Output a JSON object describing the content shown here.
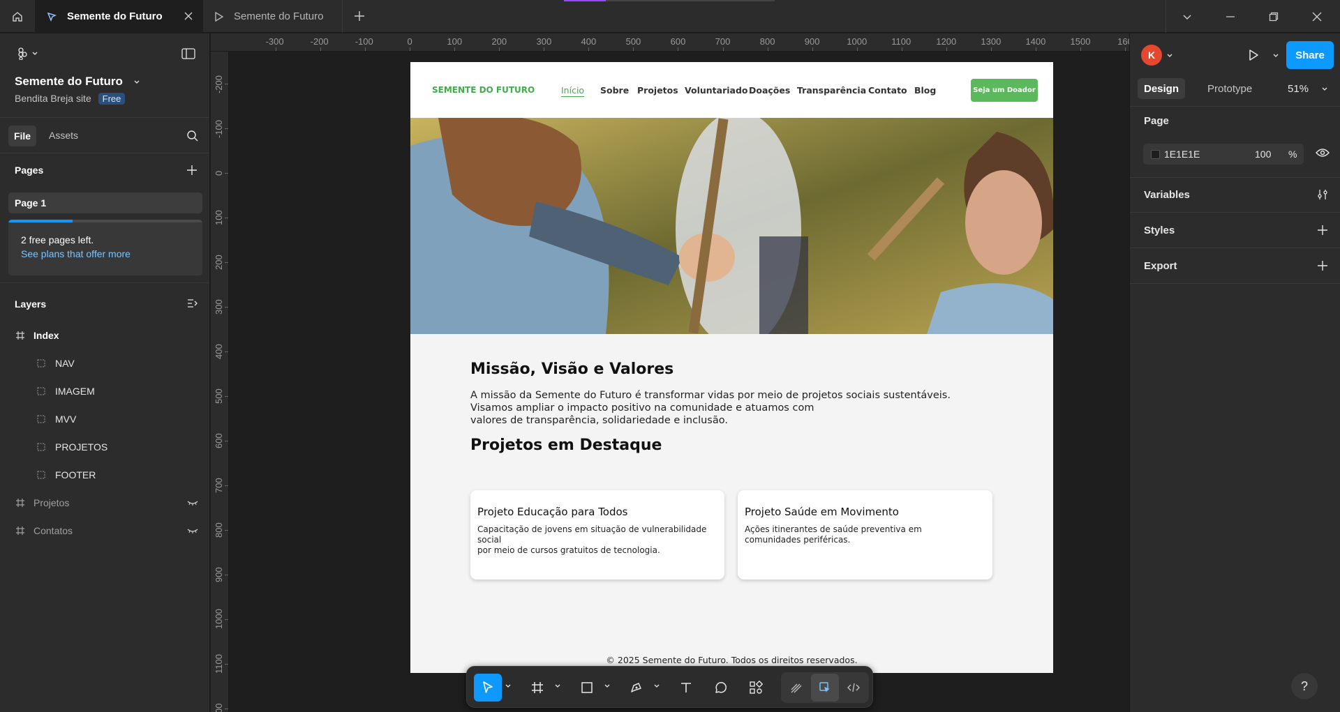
{
  "titlebar": {
    "tabs": [
      {
        "label": "Semente do Futuro",
        "active": true
      },
      {
        "label": "Semente do Futuro",
        "active": false
      }
    ]
  },
  "left_panel": {
    "file_name": "Semente do Futuro",
    "team_name": "Bendita Breja site",
    "plan_badge": "Free",
    "tabs": {
      "file": "File",
      "assets": "Assets"
    },
    "pages_header": "Pages",
    "pages": [
      "Page 1"
    ],
    "upsell": {
      "text": "2 free pages left.",
      "link": "See plans that offer more",
      "progress": 0.33
    },
    "layers_header": "Layers",
    "layers": [
      {
        "name": "Index",
        "level": 0,
        "type": "frame",
        "hidden": false
      },
      {
        "name": "NAV",
        "level": 1,
        "type": "section",
        "hidden": false
      },
      {
        "name": "IMAGEM",
        "level": 1,
        "type": "section",
        "hidden": false
      },
      {
        "name": "MVV",
        "level": 1,
        "type": "section",
        "hidden": false
      },
      {
        "name": "PROJETOS",
        "level": 1,
        "type": "section",
        "hidden": false
      },
      {
        "name": "FOOTER",
        "level": 1,
        "type": "section",
        "hidden": false
      },
      {
        "name": "Projetos",
        "level": 0,
        "type": "frame",
        "hidden": true
      },
      {
        "name": "Contatos",
        "level": 0,
        "type": "frame",
        "hidden": true
      }
    ]
  },
  "rulers": {
    "top": [
      "-300",
      "-200",
      "-100",
      "0",
      "100",
      "200",
      "300",
      "400",
      "500",
      "600",
      "700",
      "800",
      "900",
      "1000",
      "1100",
      "1200",
      "1300",
      "1400",
      "1500",
      "160"
    ],
    "left": [
      "-200",
      "-100",
      "0",
      "100",
      "200",
      "300",
      "400",
      "500",
      "600",
      "700",
      "800",
      "900",
      "1000",
      "1100",
      "00"
    ]
  },
  "frame_label": "Index",
  "site": {
    "logo": "SEMENTE DO FUTURO",
    "nav": [
      "Início",
      "Sobre",
      "Projetos",
      "Voluntariado",
      "Doações",
      "Transparência",
      "Contato",
      "Blog"
    ],
    "cta": "Seja um Doador",
    "mission_title": "Missão, Visão e Valores",
    "mission_lines": [
      "A missão da Semente do Futuro é transformar vidas por meio de projetos sociais sustentáveis.",
      "Visamos ampliar o impacto positivo na comunidade e atuamos com",
      "valores de transparência, solidariedade e inclusão."
    ],
    "projects_title": "Projetos em Destaque",
    "projects": [
      {
        "title": "Projeto Educação para Todos",
        "desc_lines": [
          "Capacitação de jovens em situação de vulnerabilidade social",
          "por meio de cursos gratuitos de tecnologia."
        ]
      },
      {
        "title": "Projeto Saúde em Movimento",
        "desc_lines": [
          "Ações itinerantes de saúde preventiva em",
          "comunidades periféricas."
        ]
      }
    ],
    "footer": "© 2025 Semente do Futuro. Todos os direitos reservados."
  },
  "toolbar": {
    "tools": [
      "move-tool",
      "frame-tool",
      "shape-tool",
      "pen-tool",
      "text-tool",
      "comment-tool",
      "actions-tool"
    ],
    "modes": [
      "draw-mode",
      "design-mode",
      "dev-mode"
    ]
  },
  "right_panel": {
    "avatar_initial": "K",
    "share_label": "Share",
    "tabs": {
      "design": "Design",
      "prototype": "Prototype"
    },
    "zoom": "51%",
    "page_section": "Page",
    "page_fill_hex": "1E1E1E",
    "page_fill_opacity": "100",
    "percent_sign": "%",
    "sections": [
      "Variables",
      "Styles",
      "Export"
    ],
    "help": "?"
  },
  "colors": {
    "accent": "#0d99ff",
    "brand_green": "#3fae4a",
    "cta_green": "#5cb85c",
    "avatar": "#e5472f",
    "canvas": "#1e1e1e",
    "panel": "#2c2c2c"
  }
}
